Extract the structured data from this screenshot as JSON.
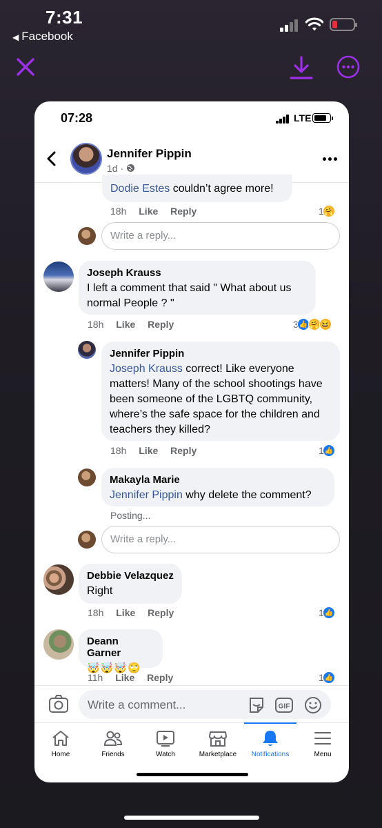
{
  "outer_status": {
    "time": "7:31",
    "back_app": "Facebook"
  },
  "viewer": {
    "accent": "#9b30e8"
  },
  "inner_status": {
    "time": "07:28",
    "network": "LTE"
  },
  "post": {
    "author": "Jennifer Pippin",
    "age": "1d ·"
  },
  "comments": [
    {
      "mention": "Dodie Estes",
      "text": " couldn’t agree more!",
      "time": "18h",
      "like": "Like",
      "reply": "Reply",
      "reactions": "1"
    },
    {
      "reply_placeholder": "Write a reply..."
    },
    {
      "name": "Joseph Krauss",
      "text": "I left a comment that said \" What about us normal People ? \"",
      "time": "18h",
      "like": "Like",
      "reply": "Reply",
      "reactions": "3"
    },
    {
      "name": "Jennifer Pippin",
      "mention": "Joseph Krauss",
      "text": " correct! Like everyone matters! Many of the school shootings have been someone of the LGBTQ community, where’s the safe space for the children and teachers they killed?",
      "time": "18h",
      "like": "Like",
      "reply": "Reply",
      "reactions": "1"
    },
    {
      "name": "Makayla Marie",
      "mention": "Jennifer Pippin",
      "text": " why delete the comment?",
      "status": "Posting..."
    },
    {
      "reply_placeholder": "Write a reply..."
    },
    {
      "name": "Debbie Velazquez",
      "text": "Right",
      "time": "18h",
      "like": "Like",
      "reply": "Reply",
      "reactions": "1"
    },
    {
      "name": "Deann Garner",
      "text": "🤯🤯🤯🙄",
      "time": "11h",
      "like": "Like",
      "reply": "Reply",
      "reactions": "1"
    }
  ],
  "comment_bar": {
    "placeholder": "Write a comment..."
  },
  "tabs": [
    {
      "label": "Home",
      "icon": "home-icon"
    },
    {
      "label": "Friends",
      "icon": "friends-icon"
    },
    {
      "label": "Watch",
      "icon": "watch-icon"
    },
    {
      "label": "Marketplace",
      "icon": "marketplace-icon"
    },
    {
      "label": "Notifications",
      "icon": "bell-icon",
      "active": true
    },
    {
      "label": "Menu",
      "icon": "menu-icon"
    }
  ],
  "colors": {
    "fb_blue": "#1877f2",
    "mention": "#385898",
    "bubble": "#f0f2f5"
  }
}
